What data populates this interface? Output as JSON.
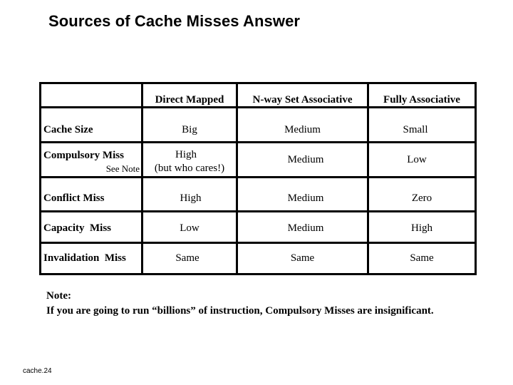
{
  "slide": {
    "title": "Sources of Cache Misses Answer",
    "footer": "cache.24"
  },
  "table": {
    "columns": [
      "",
      "Direct Mapped",
      "N-way Set Associative",
      "Fully Associative"
    ],
    "rows": [
      {
        "label": "Cache Size",
        "sublabel": "",
        "values": [
          "Big",
          "Medium",
          "Small"
        ],
        "value_notes": [
          "",
          "",
          ""
        ]
      },
      {
        "label": "Compulsory Miss",
        "sublabel": "See Note",
        "values": [
          "High",
          "Medium",
          "Low"
        ],
        "value_notes": [
          "(but who cares!)",
          "",
          ""
        ]
      },
      {
        "label": "Conflict Miss",
        "sublabel": "",
        "values": [
          "High",
          "Medium",
          "Zero"
        ],
        "value_notes": [
          "",
          "",
          ""
        ]
      },
      {
        "label": "Capacity  Miss",
        "sublabel": "",
        "values": [
          "Low",
          "Medium",
          "High"
        ],
        "value_notes": [
          "",
          "",
          ""
        ]
      },
      {
        "label": "Invalidation  Miss",
        "sublabel": "",
        "values": [
          "Same",
          "Same",
          "Same"
        ],
        "value_notes": [
          "",
          "",
          ""
        ]
      }
    ]
  },
  "note": {
    "heading": "Note:",
    "text": "If you are going to run “billions” of instruction, Compulsory Misses are insignificant."
  }
}
